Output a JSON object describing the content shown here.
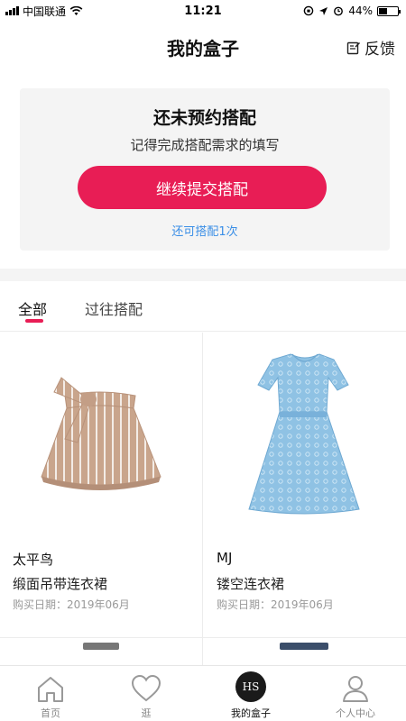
{
  "status_bar": {
    "carrier": "中国联通",
    "time": "11:21",
    "battery": "44%",
    "battery_level": 0.44
  },
  "header": {
    "title": "我的盒子",
    "feedback_label": "反馈"
  },
  "booking_card": {
    "title": "还未预约搭配",
    "subtitle": "记得完成搭配需求的填写",
    "button_label": "继续提交搭配",
    "remaining_text": "还可搭配1次"
  },
  "tabs": [
    {
      "label": "全部",
      "active": true
    },
    {
      "label": "过往搭配",
      "active": false
    }
  ],
  "products": [
    {
      "brand": "太平鸟",
      "name": "缎面吊带连衣裙",
      "date": "购买日期：2019年06月",
      "image": "beige-striped-skirt"
    },
    {
      "brand": "MJ",
      "name": "镂空连衣裙",
      "date": "购买日期：2019年06月",
      "image": "blue-lace-dress"
    }
  ],
  "tabbar": [
    {
      "label": "首页",
      "icon": "home-icon",
      "active": false
    },
    {
      "label": "逛",
      "icon": "heart-icon",
      "active": false
    },
    {
      "label": "我的盒子",
      "icon": "box-logo-icon",
      "logo_text": "HS",
      "active": true
    },
    {
      "label": "个人中心",
      "icon": "user-icon",
      "active": false
    }
  ],
  "colors": {
    "accent": "#e81d55",
    "link": "#3a8ee6",
    "card_bg": "#f4f4f4"
  }
}
